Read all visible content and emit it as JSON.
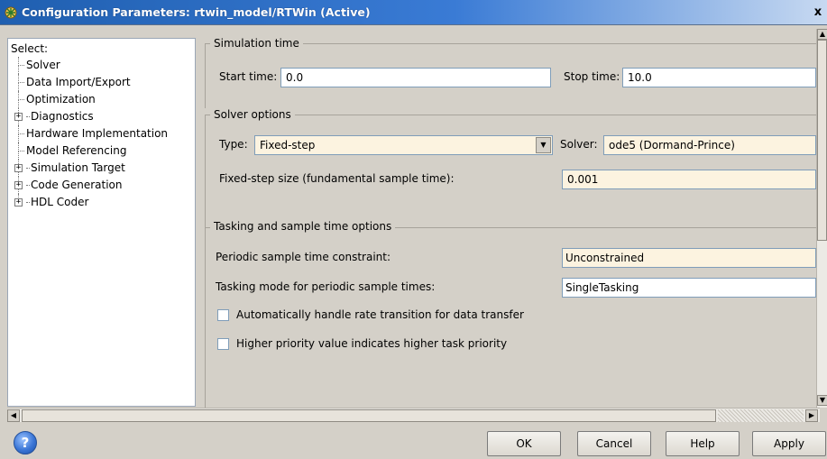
{
  "window": {
    "title": "Configuration Parameters: rtwin_model/RTWin (Active)",
    "close_label": "x"
  },
  "tree": {
    "header": "Select:",
    "items": [
      {
        "label": "Solver",
        "expandable": false,
        "selected": true
      },
      {
        "label": "Data Import/Export",
        "expandable": false
      },
      {
        "label": "Optimization",
        "expandable": false
      },
      {
        "label": "Diagnostics",
        "expandable": true
      },
      {
        "label": "Hardware Implementation",
        "expandable": false
      },
      {
        "label": "Model Referencing",
        "expandable": false
      },
      {
        "label": "Simulation Target",
        "expandable": true
      },
      {
        "label": "Code Generation",
        "expandable": true
      },
      {
        "label": "HDL Coder",
        "expandable": true
      }
    ],
    "expander_glyph": "+"
  },
  "simulation_time": {
    "title": "Simulation time",
    "start_label": "Start time:",
    "start_value": "0.0",
    "stop_label": "Stop time:",
    "stop_value": "10.0"
  },
  "solver_options": {
    "title": "Solver options",
    "type_label": "Type:",
    "type_value": "Fixed-step",
    "solver_label": "Solver:",
    "solver_value": "ode5 (Dormand-Prince)",
    "step_size_label": "Fixed-step size (fundamental sample time):",
    "step_size_value": "0.001"
  },
  "tasking": {
    "title": "Tasking and sample time options",
    "periodic_label": "Periodic sample time constraint:",
    "periodic_value": "Unconstrained",
    "mode_label": "Tasking mode for periodic sample times:",
    "mode_value": "SingleTasking",
    "checkbox_rate_label": "Automatically handle rate transition for data transfer",
    "checkbox_rate_checked": false,
    "checkbox_priority_label": "Higher priority value indicates higher task priority",
    "checkbox_priority_checked": false
  },
  "buttons": {
    "ok": "OK",
    "cancel": "Cancel",
    "help": "Help",
    "apply": "Apply",
    "help_icon_glyph": "?"
  },
  "colors": {
    "titlebar": "#1f5fb0",
    "tinted_field": "#fcf3e0",
    "dialog_bg": "#d4d0c8"
  }
}
